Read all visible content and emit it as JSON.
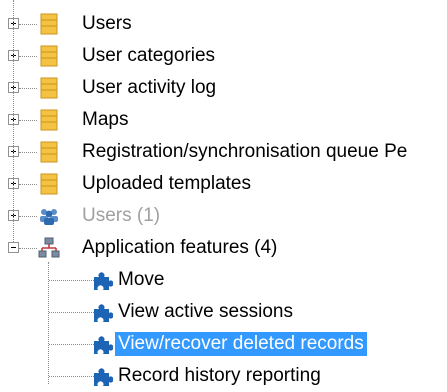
{
  "tree": {
    "items": [
      {
        "label": "Users",
        "icon": "table-folder-icon",
        "expanded": false,
        "disabled": false,
        "selected": false
      },
      {
        "label": "User categories",
        "icon": "table-folder-icon",
        "expanded": false,
        "disabled": false,
        "selected": false
      },
      {
        "label": "User activity log",
        "icon": "table-folder-icon",
        "expanded": false,
        "disabled": false,
        "selected": false
      },
      {
        "label": "Maps",
        "icon": "table-folder-icon",
        "expanded": false,
        "disabled": false,
        "selected": false
      },
      {
        "label": "Registration/synchronisation queue Pe",
        "icon": "table-folder-icon",
        "expanded": false,
        "disabled": false,
        "selected": false
      },
      {
        "label": "Uploaded templates",
        "icon": "table-folder-icon",
        "expanded": false,
        "disabled": false,
        "selected": false
      },
      {
        "label": "Users (1)",
        "icon": "users-group-icon",
        "expanded": false,
        "disabled": true,
        "selected": false
      },
      {
        "label": "Application features (4)",
        "icon": "features-network-icon",
        "expanded": true,
        "disabled": false,
        "selected": false,
        "children": [
          {
            "label": "Move",
            "icon": "puzzle-piece-icon",
            "selected": false
          },
          {
            "label": "View active sessions",
            "icon": "puzzle-piece-icon",
            "selected": false
          },
          {
            "label": "View/recover deleted records",
            "icon": "puzzle-piece-icon",
            "selected": true
          },
          {
            "label": "Record history reporting",
            "icon": "puzzle-piece-icon",
            "selected": false
          }
        ]
      }
    ]
  },
  "colors": {
    "selection": "#3399ff",
    "folder": "#f5c342",
    "puzzle": "#1e64b4",
    "disabled_text": "#a0a0a0"
  }
}
